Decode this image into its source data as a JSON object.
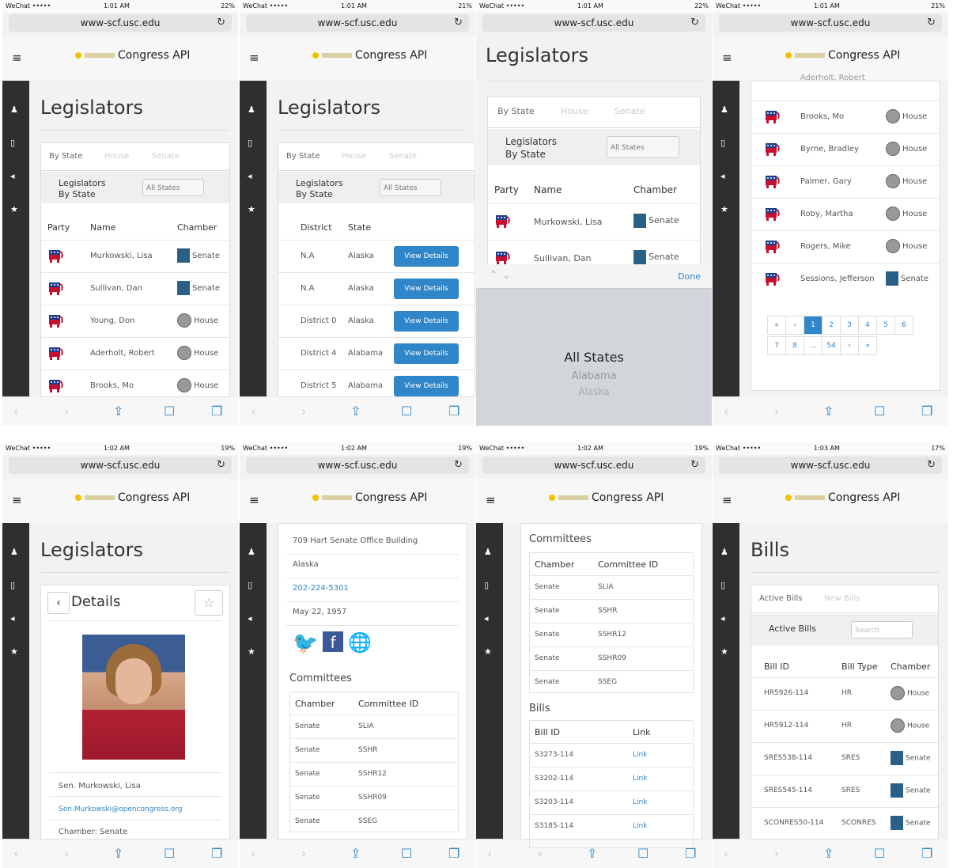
{
  "status": {
    "carrier": "WeChat •••••",
    "times": [
      "1:01 AM",
      "1:01 AM",
      "1:01 AM",
      "1:01 AM",
      "1:02 AM",
      "1:02 AM",
      "1:02 AM",
      "1:03 AM"
    ],
    "battery": [
      "22%",
      "21%",
      "22%",
      "21%",
      "19%",
      "19%",
      "19%",
      "17%"
    ]
  },
  "url": "www-scf.usc.edu",
  "app": {
    "brand": "Congress API",
    "menu_icon": "hamburger-icon"
  },
  "legislators": {
    "title": "Legislators",
    "tabs": [
      "By State",
      "House",
      "Senate"
    ],
    "filter_label": "Legislators By State",
    "select_value": "All States",
    "headers": {
      "party": "Party",
      "name": "Name",
      "chamber": "Chamber",
      "district": "District",
      "state": "State"
    },
    "rows": [
      {
        "name": "Murkowski, Lisa",
        "chamber": "Senate",
        "district": "N.A",
        "state": "Alaska"
      },
      {
        "name": "Sullivan, Dan",
        "chamber": "Senate",
        "district": "N.A",
        "state": "Alaska"
      },
      {
        "name": "Young, Don",
        "chamber": "House",
        "district": "District 0",
        "state": "Alaska"
      },
      {
        "name": "Aderholt, Robert",
        "chamber": "House",
        "district": "District 4",
        "state": "Alabama"
      },
      {
        "name": "Brooks, Mo",
        "chamber": "House",
        "district": "District 5",
        "state": "Alabama"
      }
    ],
    "view_details": "View Details"
  },
  "picker": {
    "done": "Done",
    "options": [
      "All States",
      "Alabama",
      "Alaska"
    ]
  },
  "list_end": {
    "partial": "Aderholt, Robert",
    "rows": [
      {
        "name": "Brooks, Mo",
        "chamber": "House"
      },
      {
        "name": "Byrne, Bradley",
        "chamber": "House"
      },
      {
        "name": "Palmer, Gary",
        "chamber": "House"
      },
      {
        "name": "Roby, Martha",
        "chamber": "House"
      },
      {
        "name": "Rogers, Mike",
        "chamber": "House"
      },
      {
        "name": "Sessions, Jefferson",
        "chamber": "Senate"
      }
    ],
    "pages": [
      "«",
      "‹",
      "1",
      "2",
      "3",
      "4",
      "5",
      "6",
      "7",
      "8",
      "...",
      "54",
      "›",
      "»"
    ]
  },
  "details": {
    "title": "Details",
    "name": "Sen. Murkowski, Lisa",
    "email": "Sen.Murkowski@opencongress.org",
    "chamber": "Chamber: Senate",
    "office": "709 Hart Senate Office Building",
    "state": "Alaska",
    "phone": "202-224-5301",
    "birthday": "May 22, 1957"
  },
  "committees": {
    "title": "Committees",
    "headers": [
      "Chamber",
      "Committee ID"
    ],
    "rows": [
      [
        "Senate",
        "SLIA"
      ],
      [
        "Senate",
        "SSHR"
      ],
      [
        "Senate",
        "SSHR12"
      ],
      [
        "Senate",
        "SSHR09"
      ],
      [
        "Senate",
        "SSEG"
      ]
    ]
  },
  "bills_section": {
    "title": "Bills",
    "headers": [
      "Bill ID",
      "Link"
    ],
    "rows": [
      [
        "S3273-114",
        "Link"
      ],
      [
        "S3202-114",
        "Link"
      ],
      [
        "S3203-114",
        "Link"
      ],
      [
        "S3185-114",
        "Link"
      ]
    ]
  },
  "bills_page": {
    "title": "Bills",
    "tabs": [
      "Active Bills",
      "New Bills"
    ],
    "filter_label": "Active Bills",
    "search_placeholder": "Search",
    "headers": [
      "Bill ID",
      "Bill Type",
      "Chamber"
    ],
    "rows": [
      [
        "HR5926-114",
        "HR",
        "House"
      ],
      [
        "HR5912-114",
        "HR",
        "House"
      ],
      [
        "SRES538-114",
        "SRES",
        "Senate"
      ],
      [
        "SRES545-114",
        "SRES",
        "Senate"
      ],
      [
        "SCONRES50-114",
        "SCONRES",
        "Senate"
      ]
    ]
  },
  "colors": {
    "accent": "#2f86c8",
    "sidebar": "#2f2f2f",
    "republican": "#c8102e"
  }
}
